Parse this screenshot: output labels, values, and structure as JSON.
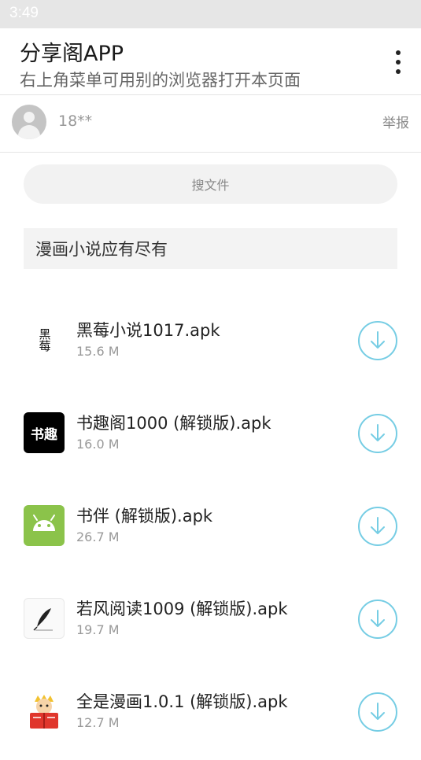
{
  "status_bar": {
    "time": "3:49"
  },
  "app_bar": {
    "title": "分享阁APP",
    "subtitle": "右上角菜单可用别的浏览器打开本页面"
  },
  "user": {
    "name": "18**",
    "report_label": "举报"
  },
  "search": {
    "label": "搜文件"
  },
  "notice": "漫画小说应有尽有",
  "files": [
    {
      "name": "黑莓小说1017.apk",
      "size": "15.6 M",
      "icon": "blackberry-novel-icon",
      "icon_text": "黑莓"
    },
    {
      "name": "书趣阁1000 (解锁版).apk",
      "size": "16.0 M",
      "icon": "shuquge-icon",
      "icon_text": "书趣"
    },
    {
      "name": "书伴 (解锁版).apk",
      "size": "26.7 M",
      "icon": "android-icon"
    },
    {
      "name": "若风阅读1009 (解锁版).apk",
      "size": "19.7 M",
      "icon": "feather-pen-icon"
    },
    {
      "name": "全是漫画1.0.1 (解锁版).apk",
      "size": "12.7 M",
      "icon": "comic-reader-icon"
    }
  ],
  "colors": {
    "accent": "#76cde4",
    "android_green": "#8bc34a"
  }
}
